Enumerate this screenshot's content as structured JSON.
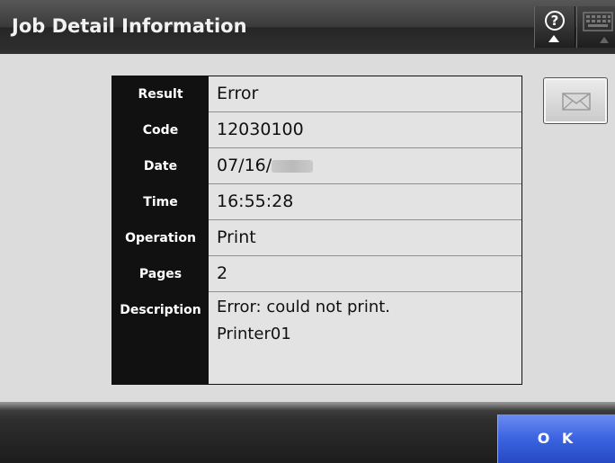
{
  "header": {
    "title": "Job Detail Information",
    "help_glyph": "?"
  },
  "details": {
    "rows": [
      {
        "label": "Result",
        "value": "Error"
      },
      {
        "label": "Code",
        "value": "12030100"
      },
      {
        "label": "Date",
        "value": "07/16/"
      },
      {
        "label": "Time",
        "value": "16:55:28"
      },
      {
        "label": "Operation",
        "value": "Print"
      },
      {
        "label": "Pages",
        "value": "2"
      }
    ],
    "description": {
      "label": "Description",
      "lines": [
        "Error: could not print.",
        "Printer01"
      ]
    }
  },
  "footer": {
    "ok_label": "O K"
  },
  "icons": {
    "help": "help-icon",
    "keyboard": "keyboard-icon",
    "mail": "mail-icon"
  },
  "colors": {
    "label_bg": "#111111",
    "value_bg": "#e3e3e3",
    "ok_button": "#3b63e0"
  }
}
